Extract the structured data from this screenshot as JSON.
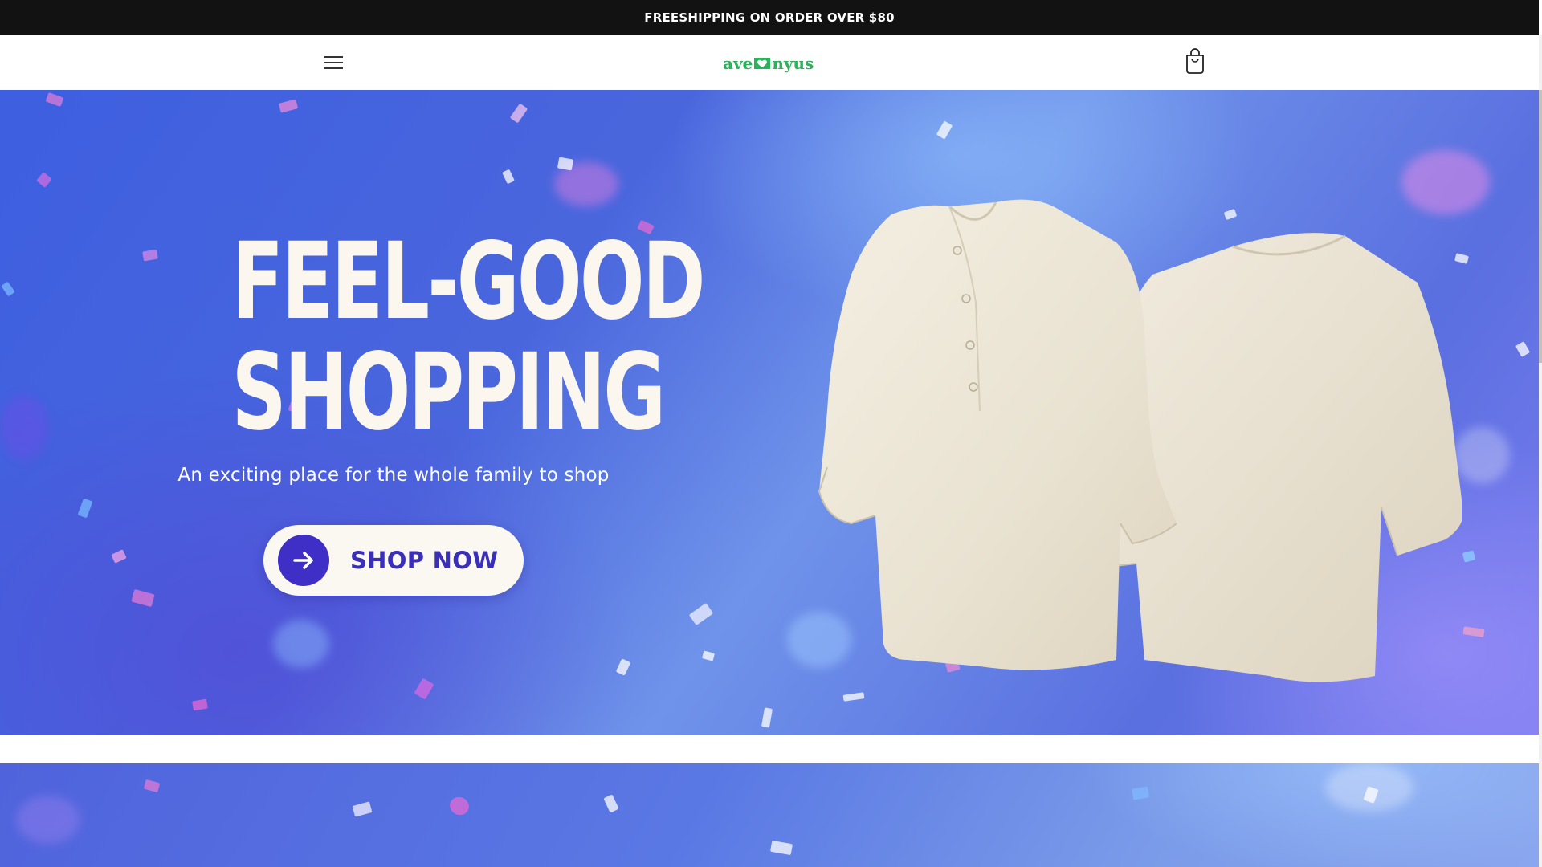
{
  "announcement": {
    "text": "FREESHIPPING ON ORDER OVER $80"
  },
  "header": {
    "logo_left": "ave",
    "logo_right": "nyus",
    "menu_icon": "hamburger-menu-icon",
    "cart_icon": "shopping-bag-icon"
  },
  "hero": {
    "headline_line1": "FEEL-GOOD",
    "headline_line2": "SHOPPING",
    "subtitle": "An exciting place for the whole family to shop",
    "cta_label": "SHOP NOW",
    "cta_icon": "arrow-right-icon",
    "image_subject": "two linen shirts"
  },
  "colors": {
    "announcement_bg": "#121212",
    "logo_green": "#2bb35a",
    "hero_blue": "#4a66dd",
    "cta_text": "#3a2fb8",
    "cta_circle": "#3f2fc6",
    "shirt_fabric": "#ece6d6"
  }
}
